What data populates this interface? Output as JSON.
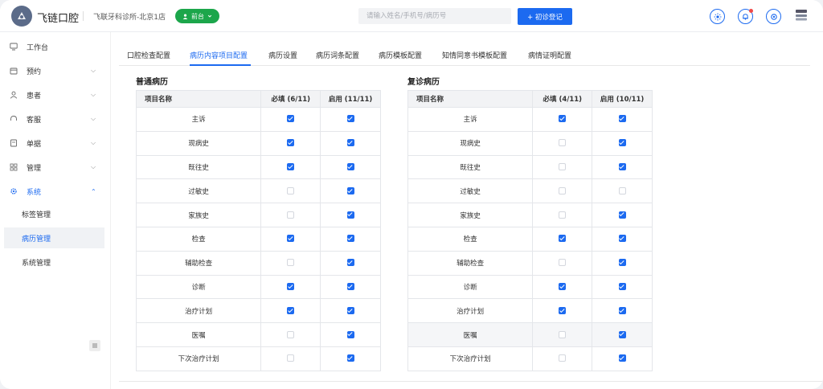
{
  "header": {
    "app_name": "飞链口腔",
    "clinic": "飞联牙科诊所-北京1店",
    "role_label": "前台",
    "search_placeholder": "请输入姓名/手机号/病历号",
    "register_label": "+ 初诊登记",
    "accent": "#1c6af0",
    "role_color": "#1ca64b"
  },
  "sidebar": {
    "items": [
      {
        "label": "工作台",
        "icon": "monitor-icon"
      },
      {
        "label": "预约",
        "icon": "calendar-icon"
      },
      {
        "label": "患者",
        "icon": "user-icon"
      },
      {
        "label": "客服",
        "icon": "headset-icon"
      },
      {
        "label": "单据",
        "icon": "document-icon"
      },
      {
        "label": "管理",
        "icon": "grid-icon"
      },
      {
        "label": "系统",
        "icon": "gear-icon"
      }
    ],
    "sub_items": [
      {
        "label": "标签管理"
      },
      {
        "label": "病历管理"
      },
      {
        "label": "系统管理"
      }
    ]
  },
  "tabs": [
    {
      "label": "口腔检查配置"
    },
    {
      "label": "病历内容项目配置"
    },
    {
      "label": "病历设置"
    },
    {
      "label": "病历词条配置"
    },
    {
      "label": "病历模板配置"
    },
    {
      "label": "知情同意书模板配置"
    },
    {
      "label": "病情证明配置"
    }
  ],
  "normal": {
    "title": "普通病历",
    "columns": [
      "项目名称",
      "必填 (6/11)",
      "启用 (11/11)"
    ],
    "rows": [
      {
        "name": "主诉",
        "required": true,
        "enabled": true
      },
      {
        "name": "现病史",
        "required": true,
        "enabled": true
      },
      {
        "name": "既往史",
        "required": true,
        "enabled": true
      },
      {
        "name": "过敏史",
        "required": false,
        "enabled": true
      },
      {
        "name": "家族史",
        "required": false,
        "enabled": true
      },
      {
        "name": "检查",
        "required": true,
        "enabled": true
      },
      {
        "name": "辅助检查",
        "required": false,
        "enabled": true
      },
      {
        "name": "诊断",
        "required": true,
        "enabled": true
      },
      {
        "name": "治疗计划",
        "required": true,
        "enabled": true
      },
      {
        "name": "医嘱",
        "required": false,
        "enabled": true
      },
      {
        "name": "下次治疗计划",
        "required": false,
        "enabled": true
      }
    ]
  },
  "revisit": {
    "title": "复诊病历",
    "columns": [
      "项目名称",
      "必填 (4/11)",
      "启用 (10/11)"
    ],
    "rows": [
      {
        "name": "主诉",
        "required": true,
        "enabled": true
      },
      {
        "name": "现病史",
        "required": false,
        "enabled": true
      },
      {
        "name": "既往史",
        "required": false,
        "enabled": true
      },
      {
        "name": "过敏史",
        "required": false,
        "enabled": false
      },
      {
        "name": "家族史",
        "required": false,
        "enabled": true
      },
      {
        "name": "检查",
        "required": true,
        "enabled": true
      },
      {
        "name": "辅助检查",
        "required": false,
        "enabled": true
      },
      {
        "name": "诊断",
        "required": true,
        "enabled": true
      },
      {
        "name": "治疗计划",
        "required": true,
        "enabled": true
      },
      {
        "name": "医嘱",
        "required": false,
        "enabled": true
      },
      {
        "name": "下次治疗计划",
        "required": false,
        "enabled": true
      }
    ]
  }
}
